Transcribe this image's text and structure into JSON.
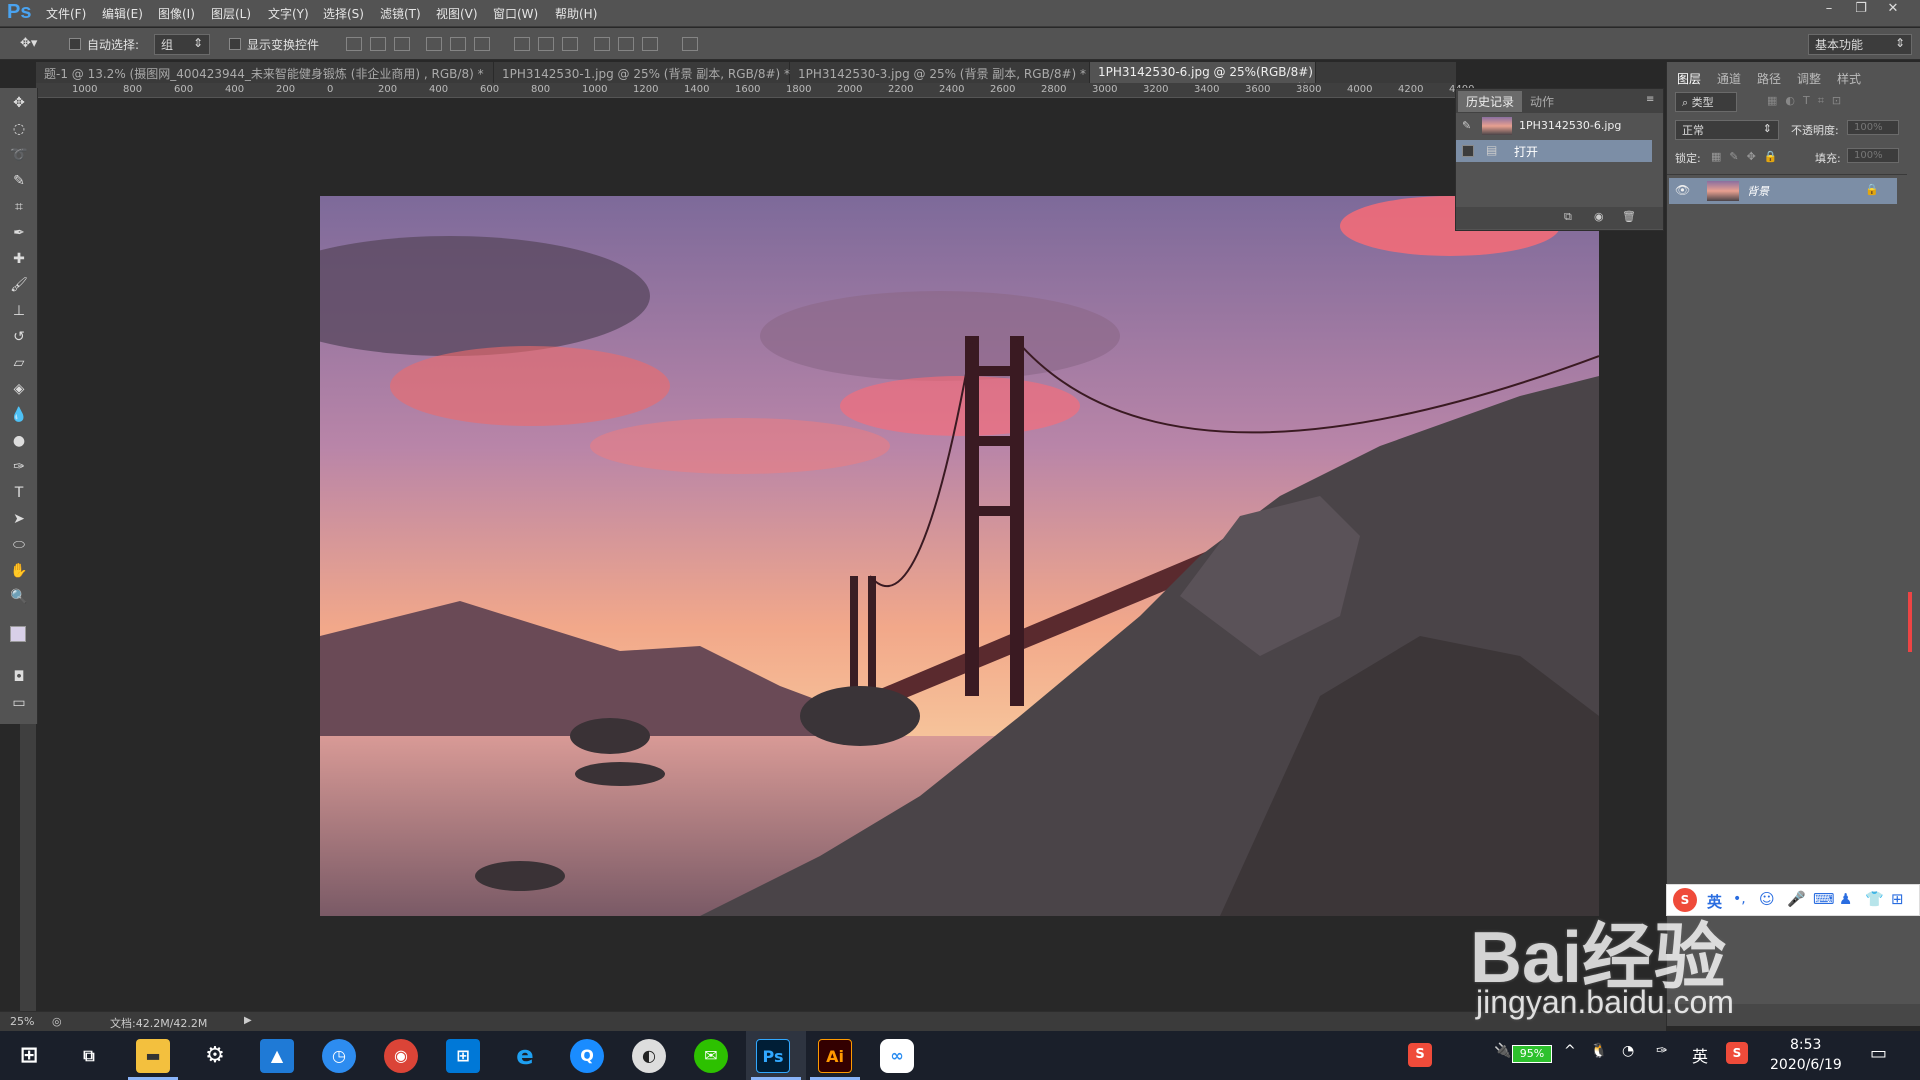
{
  "app": {
    "logo": "Ps"
  },
  "menu": [
    "文件(F)",
    "编辑(E)",
    "图像(I)",
    "图层(L)",
    "文字(Y)",
    "选择(S)",
    "滤镜(T)",
    "视图(V)",
    "窗口(W)",
    "帮助(H)"
  ],
  "window_controls": {
    "minimize": "–",
    "restore": "❐",
    "close": "✕"
  },
  "options": {
    "auto_select_label": "自动选择:",
    "auto_select_value": "组",
    "show_transform_label": "显示变换控件",
    "workspace": "基本功能"
  },
  "tabs": [
    {
      "label": "题-1 @ 13.2% (摄图网_400423944_未来智能健身锻炼 (非企业商用) , RGB/8) *",
      "active": false
    },
    {
      "label": "1PH3142530-1.jpg @ 25% (背景 副本, RGB/8#) *",
      "active": false
    },
    {
      "label": "1PH3142530-3.jpg @ 25% (背景 副本, RGB/8#) *",
      "active": false
    },
    {
      "label": "1PH3142530-6.jpg @ 25%(RGB/8#)",
      "active": true
    }
  ],
  "ruler_h": [
    "1000",
    "800",
    "600",
    "400",
    "200",
    "0",
    "200",
    "400",
    "600",
    "800",
    "1000",
    "1200",
    "1400",
    "1600",
    "1800",
    "2000",
    "2200",
    "2400",
    "2600",
    "2800",
    "3000",
    "3200",
    "3400",
    "3600",
    "3800",
    "4000",
    "4200",
    "4400"
  ],
  "ruler_v": [
    "0",
    "2 0 0",
    "4 0 0",
    "6 0 0",
    "8 0 0",
    "3 0 0"
  ],
  "history": {
    "tabs": [
      "历史记录",
      "动作"
    ],
    "snapshot": "1PH3142530-6.jpg",
    "steps": [
      "打开"
    ]
  },
  "layers_panel": {
    "tabs": [
      "图层",
      "通道",
      "路径",
      "调整",
      "样式"
    ],
    "filter": "类型",
    "blend_mode": "正常",
    "opacity_label": "不透明度:",
    "opacity_value": "100%",
    "lock_label": "锁定:",
    "fill_label": "填充:",
    "fill_value": "100%",
    "layers": [
      {
        "name": "背景",
        "locked": true,
        "visible": true
      }
    ]
  },
  "status": {
    "zoom": "25%",
    "doc": "文档:42.2M/42.2M"
  },
  "ime": {
    "lang": "英"
  },
  "watermark": {
    "brand": "Bai经验",
    "url": "jingyan.baidu.com"
  },
  "taskbar": {
    "battery": "95%",
    "ime_lang": "英",
    "time": "8:53",
    "date": "2020/6/19",
    "apps": [
      "start",
      "task-view",
      "file-explorer",
      "photos",
      "clock",
      "chrome",
      "store",
      "ie",
      "qq-browser",
      "media-player",
      "wechat",
      "photoshop",
      "illustrator",
      "baidu-netdisk"
    ]
  }
}
